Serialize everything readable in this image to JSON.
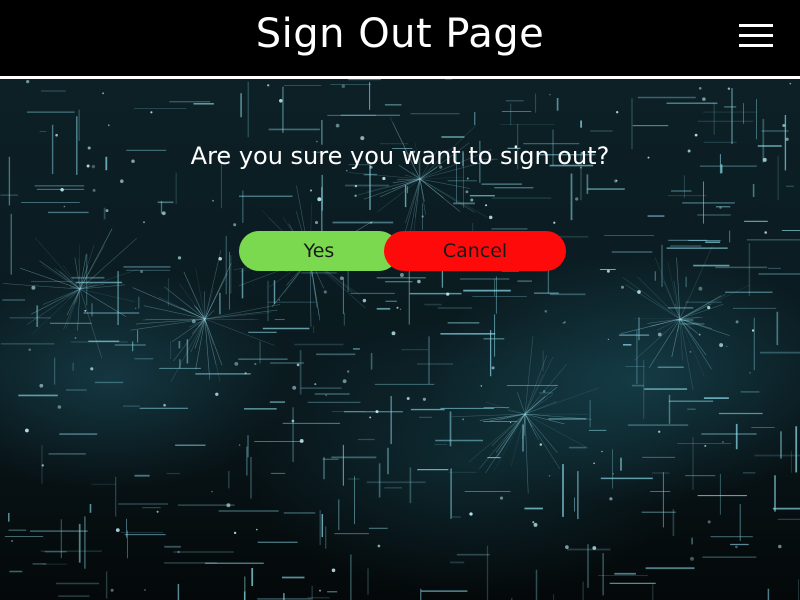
{
  "header": {
    "title": "Sign Out Page",
    "menu_icon": "hamburger-menu-icon"
  },
  "dialog": {
    "question": "Are you sure you want to sign out?",
    "yes_label": "Yes",
    "cancel_label": "Cancel"
  },
  "colors": {
    "header_bg": "#000000",
    "header_text": "#ffffff",
    "yes_button": "#7bd94f",
    "cancel_button": "#ff0a0a"
  }
}
